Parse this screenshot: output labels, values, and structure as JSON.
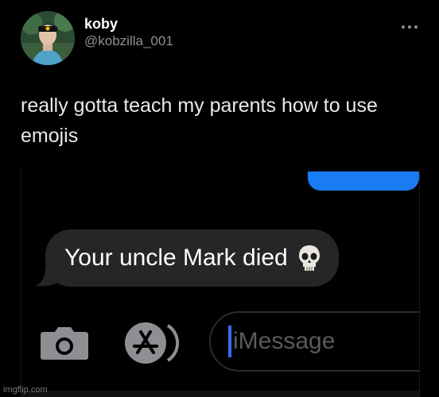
{
  "tweet": {
    "display_name": "koby",
    "handle": "@kobzilla_001",
    "text": "really gotta teach my parents how to use emojis",
    "more_icon": "more-horizontal-icon"
  },
  "conversation": {
    "sent_bubble_color": "#1a7cf5",
    "received_message": "Your uncle Mark died",
    "received_emoji": "skull-icon",
    "received_bubble_color": "#262629"
  },
  "composer": {
    "camera_icon": "camera-icon",
    "appstore_icon": "app-store-icon",
    "placeholder": "iMessage",
    "caret_color": "#3b6bf5"
  },
  "watermark": {
    "text": "imgflip.com"
  }
}
